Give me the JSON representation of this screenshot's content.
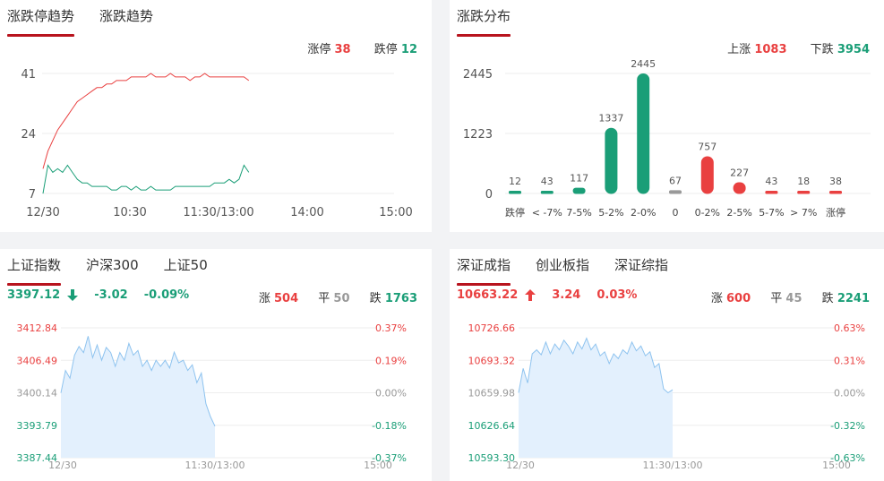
{
  "limit_trend": {
    "tabs": [
      "涨跌停趋势",
      "涨跌趋势"
    ],
    "up_label": "涨停",
    "up_value": "38",
    "down_label": "跌停",
    "down_value": "12",
    "y_ticks": [
      "41",
      "24",
      "7"
    ],
    "x_ticks": [
      "12/30",
      "10:30",
      "11:30/13:00",
      "14:00",
      "15:00"
    ],
    "colors": {
      "up": "#e94040",
      "down": "#1a9e77"
    }
  },
  "distribution": {
    "tab": "涨跌分布",
    "up_label": "上涨",
    "up_value": "1083",
    "down_label": "下跌",
    "down_value": "3954",
    "y_ticks": [
      "2445",
      "1223",
      "0"
    ]
  },
  "sh_index": {
    "tabs": [
      "上证指数",
      "沪深300",
      "上证50"
    ],
    "price": "3397.12",
    "change": "-3.02",
    "pct": "-0.09%",
    "arrow": "down-arrow-icon",
    "up_label": "涨",
    "up_count": "504",
    "flat_label": "平",
    "flat_count": "50",
    "down_label": "跌",
    "down_count": "1763",
    "left_ticks": [
      "3412.84",
      "3406.49",
      "3400.14",
      "3393.79",
      "3387.44"
    ],
    "right_ticks": [
      "0.37%",
      "0.19%",
      "0.00%",
      "-0.18%",
      "-0.37%"
    ],
    "x_ticks": [
      "12/30",
      "11:30/13:00",
      "15:00"
    ]
  },
  "sz_index": {
    "tabs": [
      "深证成指",
      "创业板指",
      "深证综指"
    ],
    "price": "10663.22",
    "change": "3.24",
    "pct": "0.03%",
    "arrow": "up-arrow-icon",
    "up_label": "涨",
    "up_count": "600",
    "flat_label": "平",
    "flat_count": "45",
    "down_label": "跌",
    "down_count": "2241",
    "left_ticks": [
      "10726.66",
      "10693.32",
      "10659.98",
      "10626.64",
      "10593.30"
    ],
    "right_ticks": [
      "0.63%",
      "0.31%",
      "0.00%",
      "-0.32%",
      "-0.63%"
    ],
    "x_ticks": [
      "12/30",
      "11:30/13:00",
      "15:00"
    ]
  },
  "chart_data": [
    {
      "type": "line",
      "tabs": [
        "涨跌停趋势",
        "涨跌趋势"
      ],
      "x_ticks": [
        "12/30",
        "10:30",
        "11:30/13:00",
        "14:00",
        "15:00"
      ],
      "ylim": [
        7,
        41
      ],
      "series": [
        {
          "name": "涨停",
          "color": "#e94040",
          "values": [
            14,
            19,
            22,
            25,
            27,
            29,
            31,
            33,
            34,
            35,
            36,
            37,
            37,
            38,
            38,
            39,
            39,
            39,
            40,
            40,
            40,
            40,
            41,
            40,
            40,
            40,
            41,
            40,
            40,
            40,
            39,
            40,
            40,
            41,
            40,
            40,
            40,
            40,
            40,
            40,
            40,
            40,
            39
          ]
        },
        {
          "name": "跌停",
          "color": "#1a9e77",
          "values": [
            7,
            15,
            13,
            14,
            13,
            15,
            13,
            11,
            10,
            10,
            9,
            9,
            9,
            9,
            8,
            8,
            9,
            9,
            8,
            9,
            8,
            8,
            9,
            8,
            8,
            8,
            8,
            9,
            9,
            9,
            9,
            9,
            9,
            9,
            9,
            10,
            10,
            10,
            11,
            10,
            11,
            15,
            13
          ]
        }
      ]
    },
    {
      "type": "bar",
      "title": "涨跌分布",
      "categories": [
        "跌停",
        "< -7%",
        "7-5%",
        "5-2%",
        "2-0%",
        "0",
        "0-2%",
        "2-5%",
        "5-7%",
        "> 7%",
        "涨停"
      ],
      "values": [
        12,
        43,
        117,
        1337,
        2445,
        67,
        757,
        227,
        43,
        18,
        38
      ],
      "colors": [
        "#1a9e77",
        "#1a9e77",
        "#1a9e77",
        "#1a9e77",
        "#1a9e77",
        "#999999",
        "#e94040",
        "#e94040",
        "#e94040",
        "#e94040",
        "#e94040"
      ],
      "ylim": [
        0,
        2445
      ]
    },
    {
      "type": "area",
      "title": "上证指数",
      "ylim": [
        3387.44,
        3412.84
      ],
      "base": 3400.14,
      "values": [
        3400.1,
        3404.5,
        3403.0,
        3407.5,
        3409.2,
        3408.0,
        3411.2,
        3407.0,
        3409.5,
        3406.5,
        3409.0,
        3408.0,
        3405.3,
        3408.0,
        3406.5,
        3409.8,
        3407.5,
        3408.4,
        3405.3,
        3406.5,
        3404.5,
        3406.5,
        3405.3,
        3406.5,
        3405.0,
        3408.1,
        3406.0,
        3406.5,
        3404.5,
        3405.6,
        3402.1,
        3404.0,
        3398.0,
        3395.5,
        3393.6
      ]
    },
    {
      "type": "area",
      "title": "深证成指",
      "ylim": [
        10593.3,
        10726.66
      ],
      "base": 10659.98,
      "values": [
        10660.0,
        10685.0,
        10670.0,
        10700.0,
        10704.0,
        10699.0,
        10712.0,
        10700.0,
        10710.0,
        10704.0,
        10714.0,
        10708.0,
        10700.0,
        10712.0,
        10705.0,
        10716.0,
        10704.0,
        10710.0,
        10698.0,
        10702.0,
        10690.0,
        10700.0,
        10695.0,
        10704.0,
        10700.0,
        10712.0,
        10703.0,
        10708.0,
        10698.0,
        10702.0,
        10686.0,
        10690.0,
        10664.0,
        10660.0,
        10663.2
      ]
    }
  ]
}
